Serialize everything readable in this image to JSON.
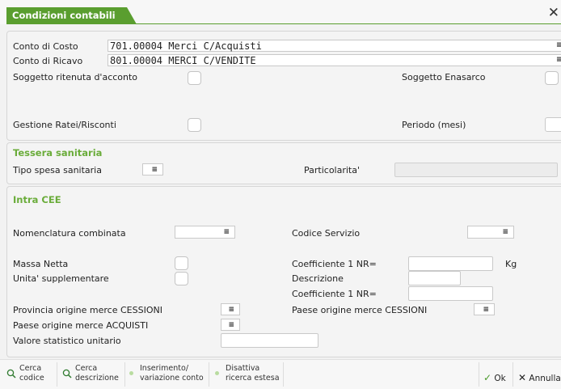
{
  "window": {
    "title": "Condizioni contabili",
    "close_icon": "close-icon"
  },
  "conti": {
    "costo_label": "Conto di Costo",
    "costo_value": "701.00004 Merci C/Acquisti",
    "ricavo_label": "Conto di Ricavo",
    "ricavo_value": "801.00004 MERCI C/VENDITE",
    "ritenuta_label": "Soggetto ritenuta d'acconto",
    "enasarco_label": "Soggetto Enasarco",
    "ratei_label": "Gestione Ratei/Risconti",
    "periodo_label": "Periodo (mesi)"
  },
  "tessera": {
    "title": "Tessera sanitaria",
    "tipo_label": "Tipo spesa sanitaria",
    "partic_label": "Particolarita'"
  },
  "intra": {
    "title": "Intra CEE",
    "nomenclatura_label": "Nomenclatura combinata",
    "codice_servizio_label": "Codice Servizio",
    "massa_label": "Massa Netta",
    "coeff1_label": "Coefficiente 1 NR=",
    "kg_label": "Kg",
    "unita_label": "Unita' supplementare",
    "descrizione_label": "Descrizione",
    "coeff2_label": "Coefficiente 1 NR=",
    "prov_cessioni_label": "Provincia origine merce CESSIONI",
    "paese_cessioni_label": "Paese origine merce CESSIONI",
    "paese_acquisti_label": "Paese origine merce ACQUISTI",
    "valore_label": "Valore statistico unitario"
  },
  "toolbar": {
    "cerca_codice_1": "Cerca",
    "cerca_codice_2": "codice",
    "cerca_desc_1": "Cerca",
    "cerca_desc_2": "descrizione",
    "ins_1": "Inserimento/",
    "ins_2": "variazione conto",
    "dis_1": "Disattiva",
    "dis_2": "ricerca estesa",
    "ok": "Ok",
    "annulla": "Annulla"
  },
  "colors": {
    "accent": "#5a9e2f",
    "section": "#6aac3a"
  }
}
